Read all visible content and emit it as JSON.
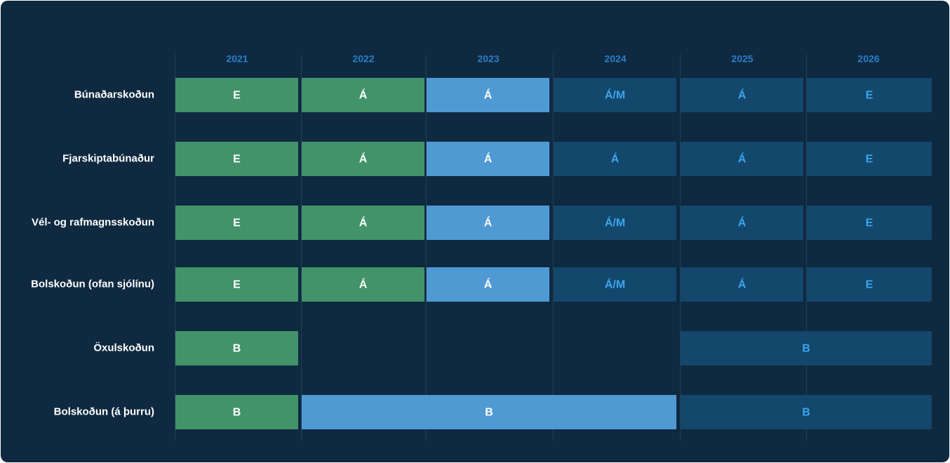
{
  "chart_data": {
    "type": "timeline",
    "years": [
      "2021",
      "2022",
      "2023",
      "2024",
      "2025",
      "2026"
    ],
    "rows": [
      {
        "label": "Búnaðarskoðun",
        "segments": [
          {
            "start": "2021",
            "end": "2021",
            "text": "E",
            "status": "completed"
          },
          {
            "start": "2022",
            "end": "2022",
            "text": "Á",
            "status": "completed"
          },
          {
            "start": "2023",
            "end": "2023",
            "text": "Á",
            "status": "current"
          },
          {
            "start": "2024",
            "end": "2024",
            "text": "Á/M",
            "status": "upcoming"
          },
          {
            "start": "2025",
            "end": "2025",
            "text": "Á",
            "status": "upcoming"
          },
          {
            "start": "2026",
            "end": "2026",
            "text": "E",
            "status": "upcoming"
          }
        ]
      },
      {
        "label": "Fjarskiptabúnaður",
        "segments": [
          {
            "start": "2021",
            "end": "2021",
            "text": "E",
            "status": "completed"
          },
          {
            "start": "2022",
            "end": "2022",
            "text": "Á",
            "status": "completed"
          },
          {
            "start": "2023",
            "end": "2023",
            "text": "Á",
            "status": "current"
          },
          {
            "start": "2024",
            "end": "2024",
            "text": "Á",
            "status": "upcoming"
          },
          {
            "start": "2025",
            "end": "2025",
            "text": "Á",
            "status": "upcoming"
          },
          {
            "start": "2026",
            "end": "2026",
            "text": "E",
            "status": "upcoming"
          }
        ]
      },
      {
        "label": "Vél- og rafmagnsskoðun",
        "segments": [
          {
            "start": "2021",
            "end": "2021",
            "text": "E",
            "status": "completed"
          },
          {
            "start": "2022",
            "end": "2022",
            "text": "Á",
            "status": "completed"
          },
          {
            "start": "2023",
            "end": "2023",
            "text": "Á",
            "status": "current"
          },
          {
            "start": "2024",
            "end": "2024",
            "text": "Á/M",
            "status": "upcoming"
          },
          {
            "start": "2025",
            "end": "2025",
            "text": "Á",
            "status": "upcoming"
          },
          {
            "start": "2026",
            "end": "2026",
            "text": "E",
            "status": "upcoming"
          }
        ]
      },
      {
        "label": "Bolskoðun (ofan sjólínu)",
        "segments": [
          {
            "start": "2021",
            "end": "2021",
            "text": "E",
            "status": "completed"
          },
          {
            "start": "2022",
            "end": "2022",
            "text": "Á",
            "status": "completed"
          },
          {
            "start": "2023",
            "end": "2023",
            "text": "Á",
            "status": "current"
          },
          {
            "start": "2024",
            "end": "2024",
            "text": "Á/M",
            "status": "upcoming"
          },
          {
            "start": "2025",
            "end": "2025",
            "text": "Á",
            "status": "upcoming"
          },
          {
            "start": "2026",
            "end": "2026",
            "text": "E",
            "status": "upcoming"
          }
        ]
      },
      {
        "label": "Öxulskoðun",
        "segments": [
          {
            "start": "2021",
            "end": "2021",
            "text": "B",
            "status": "completed"
          },
          {
            "start": "2025",
            "end": "2026",
            "text": "B",
            "status": "upcoming"
          }
        ]
      },
      {
        "label": "Bolskoðun (á þurru)",
        "segments": [
          {
            "start": "2021",
            "end": "2021",
            "text": "B",
            "status": "completed"
          },
          {
            "start": "2022",
            "end": "2024",
            "text": "B",
            "status": "current"
          },
          {
            "start": "2025",
            "end": "2026",
            "text": "B",
            "status": "upcoming"
          }
        ]
      }
    ],
    "colors": {
      "background": "#0e2940",
      "gridline": "#23405a",
      "year_label": "#2a7fc9",
      "row_label": "#ffffff",
      "completed_fill": "#429369",
      "completed_text": "#ffffff",
      "current_fill": "#509ad4",
      "current_text": "#ffffff",
      "upcoming_fill": "#13476b",
      "upcoming_text": "#3ba6ef"
    }
  }
}
